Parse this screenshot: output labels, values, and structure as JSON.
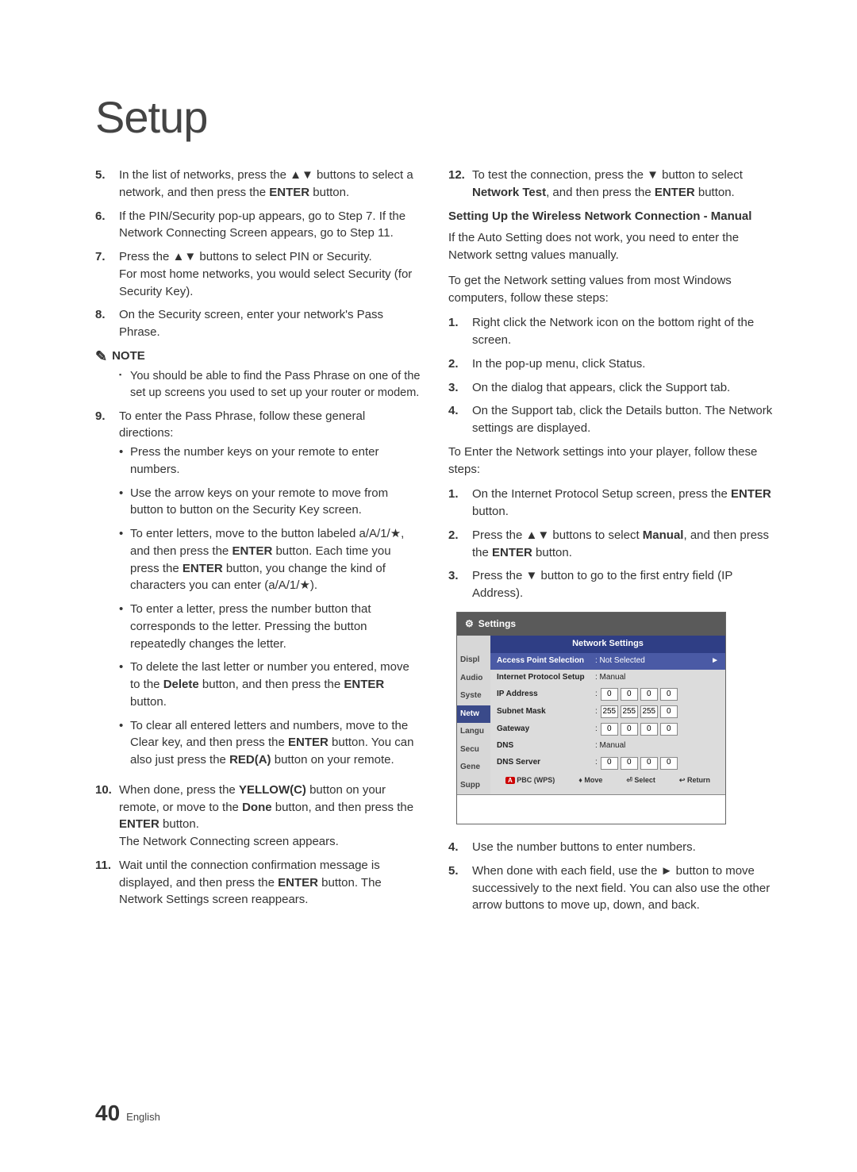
{
  "title": "Setup",
  "left": {
    "s5": {
      "n": "5.",
      "t1": "In the list of networks, press the ▲▼ buttons to select a network, and then press the ",
      "enter": "ENTER",
      "t2": " button."
    },
    "s6": {
      "n": "6.",
      "t": "If the PIN/Security pop-up appears, go to Step 7. If the Network Connecting Screen appears, go to Step 11."
    },
    "s7": {
      "n": "7.",
      "t1": "Press the ▲▼ buttons to select PIN or Security.",
      "t2": "For most home networks, you would select Security (for Security Key)."
    },
    "s8": {
      "n": "8.",
      "t": "On the Security screen, enter your network's Pass Phrase."
    },
    "note_label": "NOTE",
    "note1": "You should be able to find the Pass Phrase on one of the set up screens you used to set up your router or modem.",
    "s9": {
      "n": "9.",
      "t": "To enter the Pass Phrase, follow these general directions:"
    },
    "b1": "Press the number keys on your remote to enter numbers.",
    "b2": "Use the arrow keys on your remote to move from button to button on the Security Key screen.",
    "b3_a": "To enter letters, move to the button labeled a/A/1/★, and then press the ",
    "b3_enter": "ENTER",
    "b3_b": " button. Each time you press the ",
    "b3_c": " button, you change the kind of characters you can enter (a/A/1/★).",
    "b4": "To enter a letter, press the number button that corresponds to the letter. Pressing the button repeatedly changes the letter.",
    "b5_a": "To delete the last letter or number you entered, move to the ",
    "b5_del": "Delete",
    "b5_b": " button, and then press the ",
    "b5_enter": "ENTER",
    "b5_c": " button.",
    "b6_a": "To clear all entered letters and numbers, move to the Clear key, and then press the ",
    "b6_enter": "ENTER",
    "b6_b": " button. You can also just press the ",
    "b6_red": "RED(A)",
    "b6_c": " button on your remote.",
    "s10": {
      "n": "10.",
      "a": "When done, press the ",
      "yellow": "YELLOW(C)",
      "b": " button on your remote, or move to the ",
      "done": "Done",
      "c": " button, and then press the ",
      "enter": "ENTER",
      "d": " button.",
      "e": "The Network Connecting screen appears."
    },
    "s11": {
      "n": "11.",
      "a": "Wait until the connection confirmation message is displayed, and then press the ",
      "enter": "ENTER",
      "b": " button. The Network Settings screen reappears."
    }
  },
  "right": {
    "s12": {
      "n": "12.",
      "a": "To test the connection, press the ▼ button to select ",
      "nt": "Network Test",
      "b": ", and then press the ",
      "enter": "ENTER",
      "c": " button."
    },
    "h1": "Setting Up the Wireless Network Connection - Manual",
    "p1": "If the Auto Setting does not work, you need to enter the Network settng values manually.",
    "p2": "To get the Network setting values from most Windows computers, follow these steps:",
    "r1": {
      "n": "1.",
      "t": "Right click the Network icon on the bottom right of the screen."
    },
    "r2": {
      "n": "2.",
      "t": "In the pop-up menu, click Status."
    },
    "r3": {
      "n": "3.",
      "t": "On the dialog that appears, click the Support tab."
    },
    "r4": {
      "n": "4.",
      "t": "On the Support tab, click the Details button. The Network settings are displayed."
    },
    "p3": "To Enter the Network settings into your player, follow these steps:",
    "e1": {
      "n": "1.",
      "a": "On the Internet Protocol Setup screen, press the ",
      "enter": "ENTER",
      "b": " button."
    },
    "e2": {
      "n": "2.",
      "a": "Press the ▲▼ buttons to select ",
      "man": "Manual",
      "b": ", and then press the ",
      "enter": "ENTER",
      "c": " button."
    },
    "e3": {
      "n": "3.",
      "t": "Press the ▼ button to go to the first entry field (IP Address)."
    },
    "e4": {
      "n": "4.",
      "t": "Use the number buttons to enter numbers."
    },
    "e5": {
      "n": "5.",
      "t": "When done with each field, use the ► button to move successively to the next field. You can also use the other arrow buttons to move up, down, and back."
    }
  },
  "shot": {
    "header": "Settings",
    "panel_title": "Network Settings",
    "sidebar": [
      "Displ",
      "Audio",
      "Syste",
      "Netw",
      "Langu",
      "Secu",
      "Gene",
      "Supp"
    ],
    "rows": {
      "aps_label": "Access Point Selection",
      "aps_value": ": Not Selected",
      "ips_label": "Internet Protocol Setup",
      "ips_value": ": Manual",
      "ip_label": "IP Address",
      "subnet_label": "Subnet Mask",
      "gateway_label": "Gateway",
      "dns_label": "DNS",
      "dns_value": ": Manual",
      "dnss_label": "DNS Server"
    },
    "ip": [
      "0",
      "0",
      "0",
      "0"
    ],
    "subnet": [
      "255",
      "255",
      "255",
      "0"
    ],
    "gateway": [
      "0",
      "0",
      "0",
      "0"
    ],
    "dnss": [
      "0",
      "0",
      "0",
      "0"
    ],
    "footer": {
      "pbc_btn": "A",
      "pbc": "PBC (WPS)",
      "move": "Move",
      "select": "Select",
      "return": "Return"
    }
  },
  "footer": {
    "page": "40",
    "lang": "English"
  }
}
